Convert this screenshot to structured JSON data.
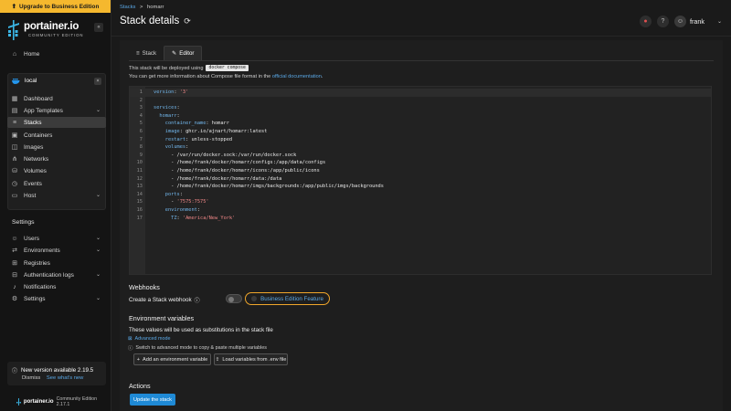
{
  "sidebar": {
    "upgrade_label": "Upgrade to Business Edition",
    "logo_text": "portainer.io",
    "logo_sub": "COMMUNITY EDITION",
    "home_label": "Home",
    "environment": {
      "name": "local",
      "items": [
        {
          "label": "Dashboard",
          "icon": "dashboard-icon"
        },
        {
          "label": "App Templates",
          "icon": "templates-icon",
          "expandable": true
        },
        {
          "label": "Stacks",
          "icon": "stacks-icon",
          "active": true
        },
        {
          "label": "Containers",
          "icon": "containers-icon"
        },
        {
          "label": "Images",
          "icon": "images-icon"
        },
        {
          "label": "Networks",
          "icon": "networks-icon"
        },
        {
          "label": "Volumes",
          "icon": "volumes-icon"
        },
        {
          "label": "Events",
          "icon": "events-icon"
        },
        {
          "label": "Host",
          "icon": "host-icon",
          "expandable": true
        }
      ]
    },
    "settings_heading": "Settings",
    "settings_items": [
      {
        "label": "Users",
        "icon": "users-icon",
        "expandable": true
      },
      {
        "label": "Environments",
        "icon": "environments-icon",
        "expandable": true
      },
      {
        "label": "Registries",
        "icon": "registries-icon"
      },
      {
        "label": "Authentication logs",
        "icon": "auth-logs-icon",
        "expandable": true
      },
      {
        "label": "Notifications",
        "icon": "bell-icon"
      },
      {
        "label": "Settings",
        "icon": "gear-icon",
        "expandable": true
      }
    ],
    "update": {
      "title": "New version available 2.19.5",
      "dismiss": "Dismiss",
      "whats_new": "See what's new"
    },
    "footer": {
      "brand": "portainer.io",
      "edition": "Community Edition 2.17.1"
    }
  },
  "header": {
    "breadcrumb_link": "Stacks",
    "breadcrumb_sep": ">",
    "breadcrumb_current": "homarr",
    "title": "Stack details",
    "user": "frank"
  },
  "tabs": [
    {
      "label": "Stack",
      "icon": "list-icon"
    },
    {
      "label": "Editor",
      "icon": "pencil-icon",
      "active": true
    }
  ],
  "editor_info": {
    "deploy_prefix": "This stack will be deployed using",
    "deploy_tool": "docker compose",
    "compose_prefix": "You can get more information about Compose file format in the",
    "compose_link": "official documentation",
    "compose_suffix": "."
  },
  "code_lines": [
    "version: '3'",
    "",
    "services:",
    "  homarr:",
    "    container_name: homarr",
    "    image: ghcr.io/ajnart/homarr:latest",
    "    restart: unless-stopped",
    "    volumes:",
    "      - /var/run/docker.sock:/var/run/docker.sock",
    "      - /home/frank/docker/homarr/configs:/app/data/configs",
    "      - /home/frank/docker/homarr/icons:/app/public/icons",
    "      - /home/frank/docker/homarr/data:/data",
    "      - /home/frank/docker/homarr/imgs/backgrounds:/app/public/imgs/backgrounds",
    "    ports:",
    "      - '7575:7575'",
    "    environment:",
    "      TZ: 'America/New_York'"
  ],
  "webhooks": {
    "title": "Webhooks",
    "label": "Create a Stack webhook",
    "be_feature": "Business Edition Feature"
  },
  "env_vars": {
    "title": "Environment variables",
    "desc": "These values will be used as substitutions in the stack file",
    "advanced_mode": "Advanced mode",
    "advanced_note": "Switch to advanced mode to copy & paste multiple variables",
    "add_button": "Add an environment variable",
    "load_button": "Load variables from .env file"
  },
  "actions": {
    "title": "Actions",
    "update_button": "Update the stack"
  }
}
